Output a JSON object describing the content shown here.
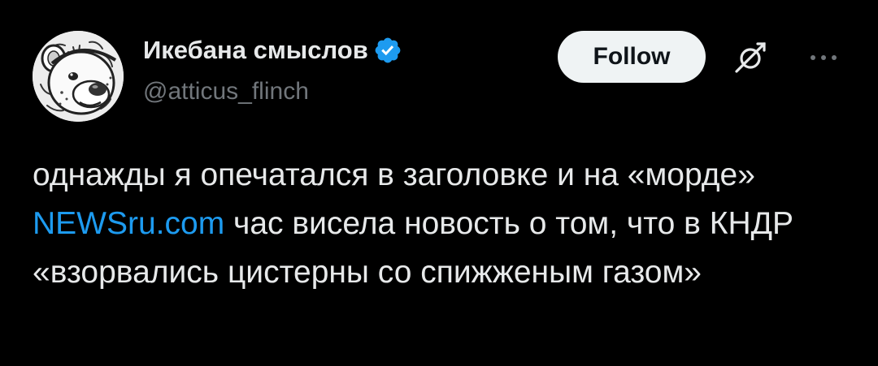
{
  "author": {
    "display_name": "Икебана смыслов",
    "handle": "@atticus_flinch",
    "verified": true,
    "avatar_icon": "cartoon-bear-avatar-icon"
  },
  "actions": {
    "follow_label": "Follow",
    "grok_icon": "grok-icon",
    "more_icon": "more-options-icon"
  },
  "tweet": {
    "text_before_link": "однажды я опечатался в заголовке и на «морде» ",
    "link_text": "NEWSru.com",
    "text_after_link": " час висела новость о том, что в КНДР «взорвались цистерны со спижженым газом»"
  },
  "colors": {
    "background": "#000000",
    "text": "#e7e9ea",
    "secondary_text": "#71767b",
    "link": "#1d9bf0",
    "verified_badge": "#1d9bf0",
    "follow_button_bg": "#eff3f4"
  }
}
